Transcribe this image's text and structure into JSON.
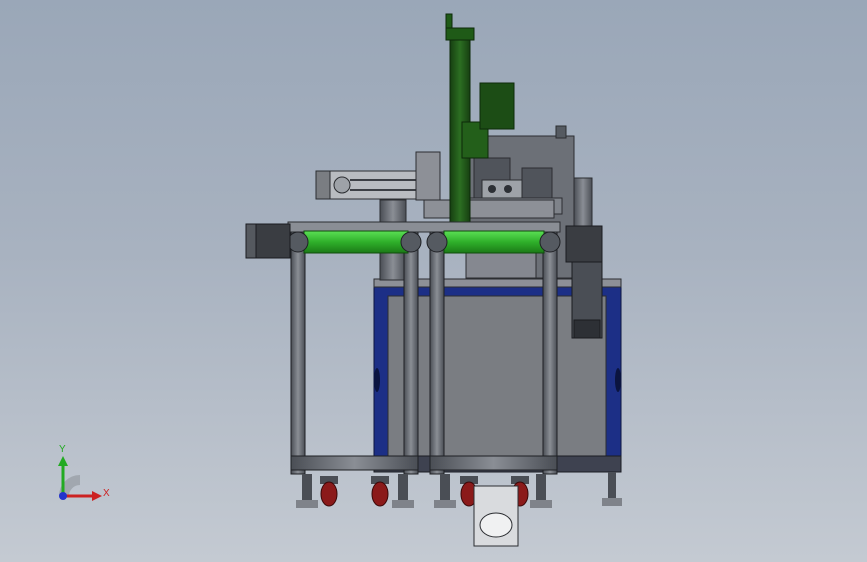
{
  "viewport": {
    "background_top": "#9aa7b8",
    "background_bottom": "#c4cad2"
  },
  "model": {
    "name": "machine-assembly",
    "colors": {
      "frame_blue": "#1c2f86",
      "panel_gray": "#7a7d82",
      "aluminum": "#5b5f66",
      "aluminum_dark": "#3c3f45",
      "pipe_green": "#2fb02a",
      "column_green": "#1f5a17",
      "motor_dark": "#3a3d42",
      "caster_red": "#8b1a1a"
    }
  },
  "triad": {
    "x_label": "X",
    "y_label": "Y",
    "x_color": "#cc2222",
    "y_color": "#22aa22",
    "z_color": "#2233cc"
  }
}
